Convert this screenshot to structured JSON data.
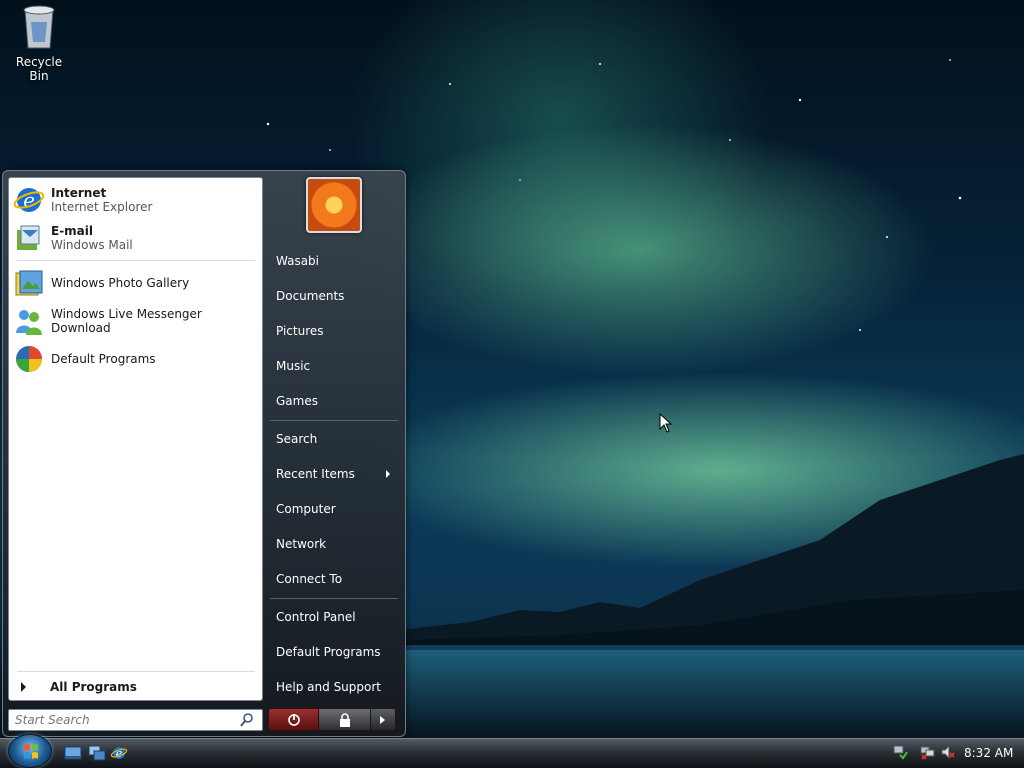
{
  "desktop": {
    "recycle_bin_label": "Recycle Bin"
  },
  "start_menu": {
    "pinned": [
      {
        "title": "Internet",
        "subtitle": "Internet Explorer",
        "icon": "internet-explorer-icon"
      },
      {
        "title": "E-mail",
        "subtitle": "Windows Mail",
        "icon": "windows-mail-icon"
      }
    ],
    "recent": [
      {
        "title": "Windows Photo Gallery",
        "icon": "photo-gallery-icon"
      },
      {
        "title": "Windows Live Messenger Download",
        "icon": "messenger-icon"
      },
      {
        "title": "Default Programs",
        "icon": "default-programs-icon"
      }
    ],
    "all_programs": "All Programs",
    "search_placeholder": "Start Search",
    "right_items": [
      {
        "label": "Wasabi"
      },
      {
        "label": "Documents"
      },
      {
        "label": "Pictures"
      },
      {
        "label": "Music"
      },
      {
        "label": "Games"
      },
      {
        "label": "Search"
      },
      {
        "label": "Recent Items",
        "submenu": true
      },
      {
        "label": "Computer"
      },
      {
        "label": "Network"
      },
      {
        "label": "Connect To"
      },
      {
        "label": "Control Panel"
      },
      {
        "label": "Default Programs"
      },
      {
        "label": "Help and Support"
      }
    ]
  },
  "taskbar": {
    "clock": "8:32 AM",
    "quick_launch": [
      "show-desktop-icon",
      "switch-windows-icon",
      "internet-explorer-icon"
    ],
    "tray": [
      "network-icon",
      "network-disconnected-icon",
      "volume-muted-icon"
    ]
  },
  "colors": {
    "power_button": "#9a3030",
    "menu_text": "#ffffff"
  }
}
